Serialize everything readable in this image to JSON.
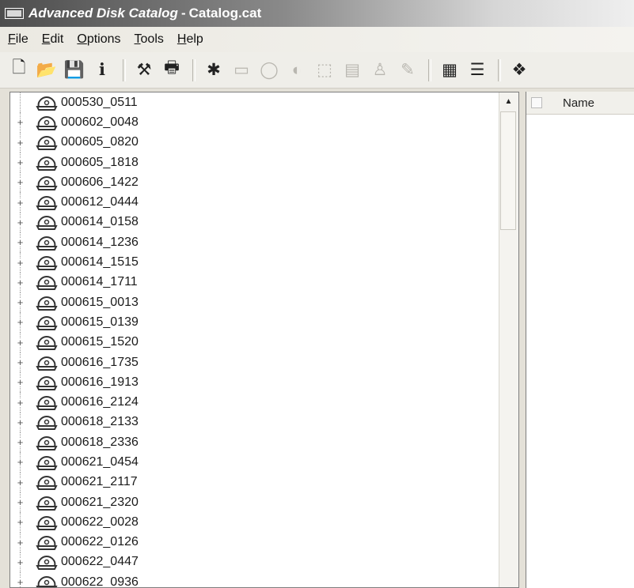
{
  "window": {
    "app_title": "Advanced Disk Catalog",
    "separator": "-",
    "document_title": "Catalog.cat"
  },
  "menu": [
    {
      "label": "File",
      "accel": "F",
      "rest": "ile"
    },
    {
      "label": "Edit",
      "accel": "E",
      "rest": "dit"
    },
    {
      "label": "Options",
      "accel": "O",
      "rest": "ptions"
    },
    {
      "label": "Tools",
      "accel": "T",
      "rest": "ools"
    },
    {
      "label": "Help",
      "accel": "H",
      "rest": "elp"
    }
  ],
  "toolbar": {
    "buttons": [
      {
        "name": "new-icon",
        "glyph": "🗋",
        "enabled": true
      },
      {
        "name": "open-icon",
        "glyph": "📂",
        "enabled": true
      },
      {
        "name": "save-icon",
        "glyph": "💾",
        "enabled": false
      },
      {
        "name": "info-icon",
        "glyph": "ℹ",
        "enabled": true
      },
      {
        "name": "tools-icon",
        "glyph": "⚒",
        "enabled": true
      },
      {
        "name": "print-icon",
        "glyph": "🖶",
        "enabled": true
      },
      {
        "name": "add-disk-icon",
        "glyph": "✱",
        "enabled": true
      },
      {
        "name": "folder-icon",
        "glyph": "▭",
        "enabled": false
      },
      {
        "name": "disk-icon",
        "glyph": "◯",
        "enabled": false
      },
      {
        "name": "search-disk-icon",
        "glyph": "◐",
        "enabled": false
      },
      {
        "name": "properties-icon",
        "glyph": "⬚",
        "enabled": false
      },
      {
        "name": "table-icon",
        "glyph": "▤",
        "enabled": false
      },
      {
        "name": "user-icon",
        "glyph": "♙",
        "enabled": false
      },
      {
        "name": "pencil-icon",
        "glyph": "✎",
        "enabled": false
      },
      {
        "name": "grid-view-icon",
        "glyph": "▦",
        "enabled": true
      },
      {
        "name": "list-view-icon",
        "glyph": "☰",
        "enabled": true
      },
      {
        "name": "catalog-icon",
        "glyph": "❖",
        "enabled": true
      }
    ]
  },
  "tree": {
    "nodes": [
      "000530_0511",
      "000602_0048",
      "000605_0820",
      "000605_1818",
      "000606_1422",
      "000612_0444",
      "000614_0158",
      "000614_1236",
      "000614_1515",
      "000614_1711",
      "000615_0013",
      "000615_0139",
      "000615_1520",
      "000616_1735",
      "000616_1913",
      "000616_2124",
      "000618_2133",
      "000618_2336",
      "000621_0454",
      "000621_2117",
      "000621_2320",
      "000622_0028",
      "000622_0126",
      "000622_0447",
      "000622_0936"
    ],
    "first_node_expandable": false
  },
  "details": {
    "columns": [
      {
        "label": "Name"
      }
    ]
  }
}
